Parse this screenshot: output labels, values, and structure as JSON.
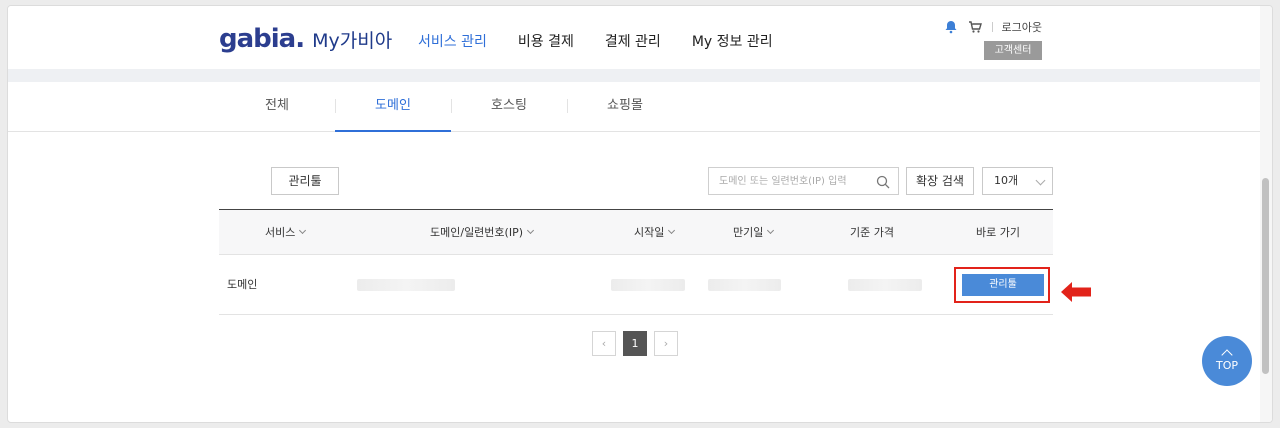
{
  "header": {
    "logo": "gabia.",
    "logo_sub": "My가비아",
    "nav": [
      "서비스 관리",
      "비용 결제",
      "결제 관리",
      "My 정보 관리"
    ],
    "logout": "로그아웃",
    "customer_center": "고객센터",
    "icons": [
      "bell-icon",
      "cart-icon"
    ]
  },
  "tabs": [
    "전체",
    "도메인",
    "호스팅",
    "쇼핑몰"
  ],
  "toolbar": {
    "manage_tool": "관리툴",
    "search_placeholder": "도메인 또는 일련번호(IP) 입력",
    "advanced_search": "확장 검색",
    "page_size": "10개"
  },
  "table": {
    "headers": [
      "서비스",
      "도메인/일련번호(IP)",
      "시작일",
      "만기일",
      "기준 가격",
      "바로 가기"
    ],
    "rows": [
      {
        "service": "도메인",
        "action": "관리툴"
      }
    ]
  },
  "pagination": {
    "prev": "‹",
    "current": "1",
    "next": "›"
  },
  "top_button": "TOP",
  "colors": {
    "accent": "#2f6fd8",
    "button": "#4a8ad8",
    "highlight": "#e2231a"
  }
}
